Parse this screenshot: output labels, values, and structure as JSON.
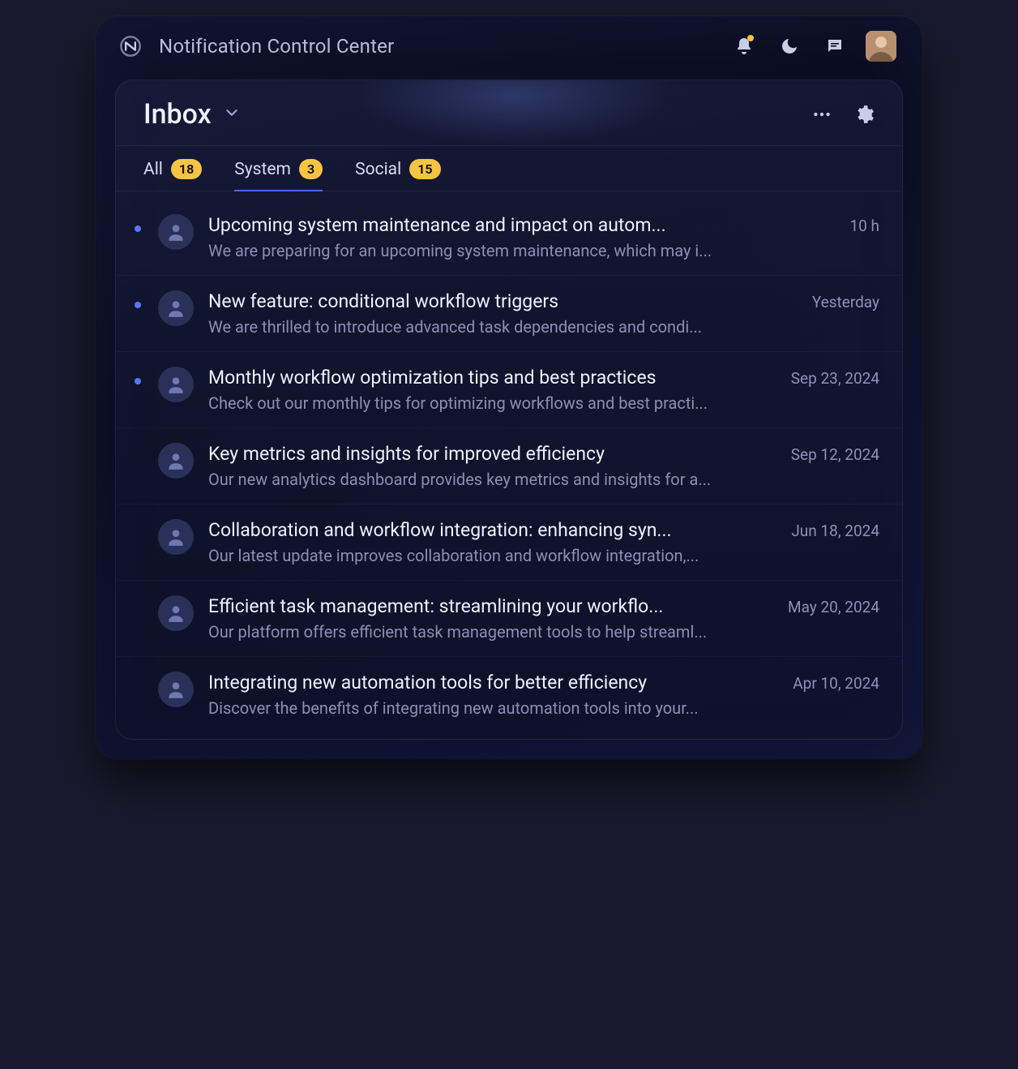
{
  "app": {
    "title": "Notification Control Center"
  },
  "panel": {
    "title": "Inbox"
  },
  "tabs": [
    {
      "label": "All",
      "count": "18",
      "active": false
    },
    {
      "label": "System",
      "count": "3",
      "active": true
    },
    {
      "label": "Social",
      "count": "15",
      "active": false
    }
  ],
  "items": [
    {
      "unread": true,
      "title": "Upcoming system maintenance and impact on autom...",
      "time": "10 h",
      "snippet": "We are preparing for an upcoming system maintenance, which may i..."
    },
    {
      "unread": true,
      "title": "New feature: conditional workflow triggers",
      "time": "Yesterday",
      "snippet": "We are thrilled to introduce advanced task dependencies and condi..."
    },
    {
      "unread": true,
      "title": "Monthly workflow optimization tips and best practices",
      "time": "Sep 23, 2024",
      "snippet": "Check out our monthly tips for optimizing workflows and best practi..."
    },
    {
      "unread": false,
      "title": "Key metrics and insights for improved efficiency",
      "time": "Sep 12, 2024",
      "snippet": "Our new analytics dashboard provides key metrics and insights for a..."
    },
    {
      "unread": false,
      "title": "Collaboration and workflow integration: enhancing syn...",
      "time": "Jun 18, 2024",
      "snippet": "Our latest update improves collaboration and workflow integration,..."
    },
    {
      "unread": false,
      "title": "Efficient task management: streamlining your workflo...",
      "time": "May 20, 2024",
      "snippet": "Our platform offers efficient task management tools to help streaml..."
    },
    {
      "unread": false,
      "title": "Integrating new automation tools for better efficiency",
      "time": "Apr 10, 2024",
      "snippet": "Discover the benefits of integrating new automation tools into your..."
    }
  ]
}
